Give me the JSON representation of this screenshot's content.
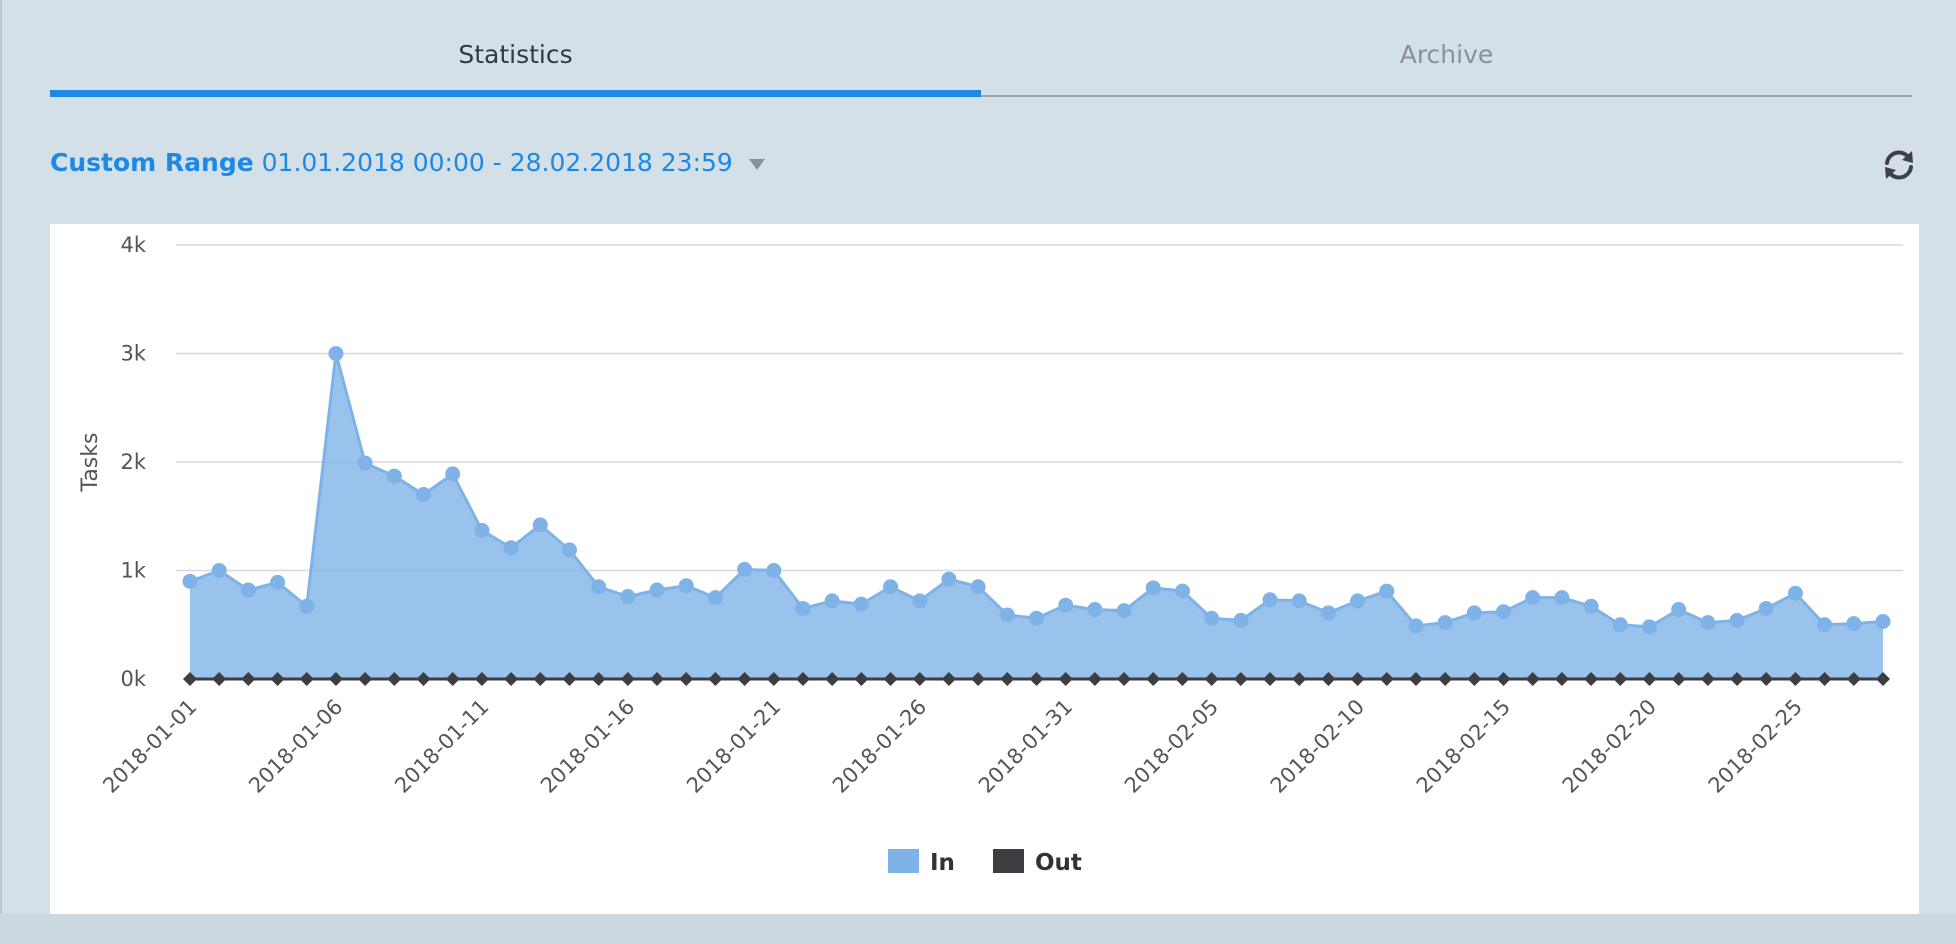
{
  "tabs": [
    {
      "label": "Statistics",
      "active": true
    },
    {
      "label": "Archive",
      "active": false
    }
  ],
  "range": {
    "label": "Custom Range",
    "value": "01.01.2018 00:00 - 28.02.2018 23:59"
  },
  "icons": {
    "refresh": "refresh-icon",
    "dropdown": "caret-down-icon"
  },
  "colors": {
    "accent": "#1e88e5",
    "in_series": "#7fb3e8",
    "out_series": "#3d3e42"
  },
  "chart_data": {
    "type": "area",
    "ylabel": "Tasks",
    "xlabel": "",
    "ylim": [
      0,
      4000
    ],
    "yticks": [
      0,
      1000,
      2000,
      3000,
      4000
    ],
    "ytick_labels": [
      "0k",
      "1k",
      "2k",
      "3k",
      "4k"
    ],
    "xtick_labels": [
      "2018-01-01",
      "2018-01-06",
      "2018-01-11",
      "2018-01-16",
      "2018-01-21",
      "2018-01-26",
      "2018-01-31",
      "2018-02-05",
      "2018-02-10",
      "2018-02-15",
      "2018-02-20",
      "2018-02-25"
    ],
    "x": [
      "2018-01-01",
      "2018-01-02",
      "2018-01-03",
      "2018-01-04",
      "2018-01-05",
      "2018-01-06",
      "2018-01-07",
      "2018-01-08",
      "2018-01-09",
      "2018-01-10",
      "2018-01-11",
      "2018-01-12",
      "2018-01-13",
      "2018-01-14",
      "2018-01-15",
      "2018-01-16",
      "2018-01-17",
      "2018-01-18",
      "2018-01-19",
      "2018-01-20",
      "2018-01-21",
      "2018-01-22",
      "2018-01-23",
      "2018-01-24",
      "2018-01-25",
      "2018-01-26",
      "2018-01-27",
      "2018-01-28",
      "2018-01-29",
      "2018-01-30",
      "2018-01-31",
      "2018-02-01",
      "2018-02-02",
      "2018-02-03",
      "2018-02-04",
      "2018-02-05",
      "2018-02-06",
      "2018-02-07",
      "2018-02-08",
      "2018-02-09",
      "2018-02-10",
      "2018-02-11",
      "2018-02-12",
      "2018-02-13",
      "2018-02-14",
      "2018-02-15",
      "2018-02-16",
      "2018-02-17",
      "2018-02-18",
      "2018-02-19",
      "2018-02-20",
      "2018-02-21",
      "2018-02-22",
      "2018-02-23",
      "2018-02-24",
      "2018-02-25",
      "2018-02-26",
      "2018-02-27",
      "2018-02-28"
    ],
    "series": [
      {
        "name": "In",
        "values": [
          900,
          1000,
          820,
          890,
          670,
          3000,
          1990,
          1870,
          1700,
          1890,
          1370,
          1210,
          1420,
          1190,
          850,
          760,
          820,
          860,
          750,
          1010,
          1000,
          650,
          720,
          690,
          850,
          720,
          920,
          850,
          590,
          560,
          680,
          640,
          630,
          840,
          810,
          560,
          540,
          730,
          720,
          610,
          720,
          810,
          490,
          520,
          610,
          620,
          750,
          750,
          670,
          500,
          480,
          640,
          520,
          540,
          650,
          790,
          500,
          510,
          530
        ]
      },
      {
        "name": "Out",
        "values": [
          0,
          0,
          0,
          0,
          0,
          0,
          0,
          0,
          0,
          0,
          0,
          0,
          0,
          0,
          0,
          0,
          0,
          0,
          0,
          0,
          0,
          0,
          0,
          0,
          0,
          0,
          0,
          0,
          0,
          0,
          0,
          0,
          0,
          0,
          0,
          0,
          0,
          0,
          0,
          0,
          0,
          0,
          0,
          0,
          0,
          0,
          0,
          0,
          0,
          0,
          0,
          0,
          0,
          0,
          0,
          0,
          0,
          0,
          0
        ]
      }
    ],
    "grid": true,
    "legend": "bottom-center"
  }
}
